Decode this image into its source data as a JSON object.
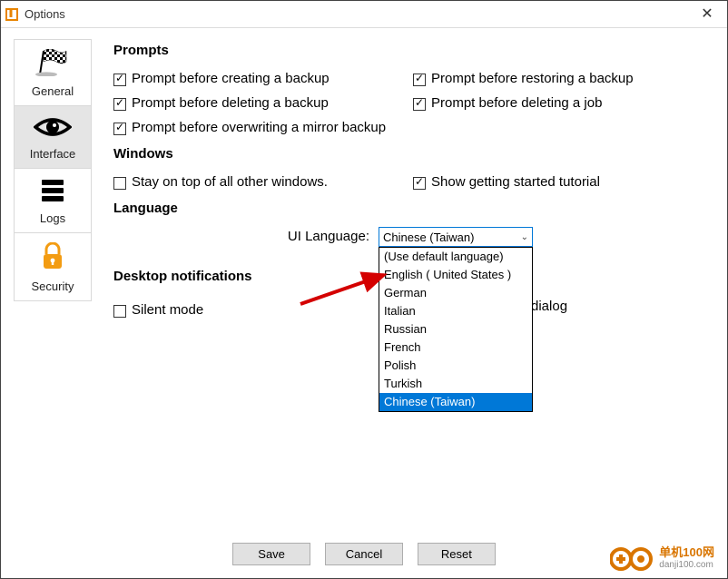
{
  "window": {
    "title": "Options"
  },
  "sidebar": {
    "items": [
      {
        "label": "General"
      },
      {
        "label": "Interface"
      },
      {
        "label": "Logs"
      },
      {
        "label": "Security"
      }
    ]
  },
  "sections": {
    "prompts": {
      "title": "Prompts",
      "create": "Prompt before creating a backup",
      "restore": "Prompt before restoring a backup",
      "delete_backup": "Prompt before deleting a backup",
      "delete_job": "Prompt before deleting a job",
      "overwrite": "Prompt before overwriting a mirror backup"
    },
    "windows": {
      "title": "Windows",
      "stay_on_top": "Stay on top of all other windows.",
      "tutorial": "Show getting started tutorial"
    },
    "language": {
      "title": "Language",
      "label": "UI Language:",
      "selected": "Chinese (Taiwan)",
      "options": [
        "(Use default language)",
        "English ( United States )",
        "German",
        "Italian",
        "Russian",
        "French",
        "Polish",
        "Turkish",
        "Chinese (Taiwan)"
      ]
    },
    "notifications": {
      "title": "Desktop notifications",
      "silent": "Silent mode",
      "dialog_text": "dialog"
    }
  },
  "footer": {
    "save": "Save",
    "cancel": "Cancel",
    "reset": "Reset"
  },
  "watermark": {
    "line1": "单机100网",
    "line2": "danji100.com"
  }
}
